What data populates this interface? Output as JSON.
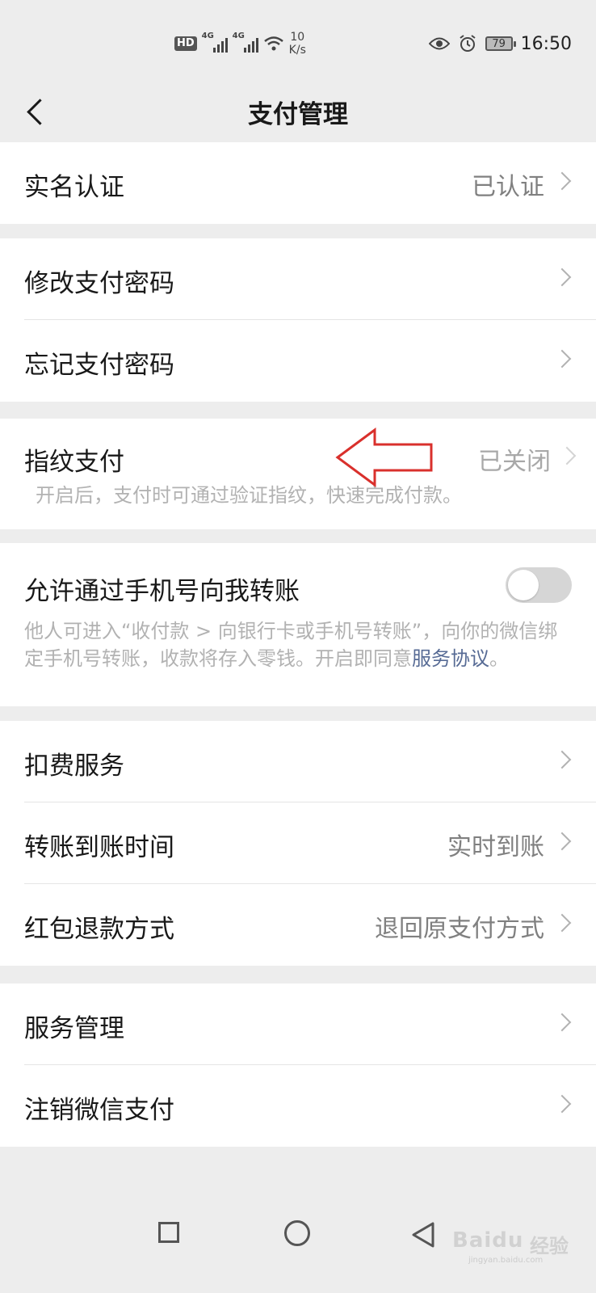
{
  "status_bar": {
    "hd": "HD",
    "network_1": "4G",
    "network_2": "4G",
    "speed_value": "10",
    "speed_unit": "K/s",
    "battery": "79",
    "time": "16:50"
  },
  "header": {
    "title": "支付管理"
  },
  "sections": {
    "real_name": {
      "label": "实名认证",
      "value": "已认证"
    },
    "password": {
      "change_label": "修改支付密码",
      "forgot_label": "忘记支付密码"
    },
    "fingerprint": {
      "label": "指纹支付",
      "value": "已关闭",
      "description": "开启后，支付时可通过验证指纹，快速完成付款。"
    },
    "phone_transfer": {
      "label": "允许通过手机号向我转账",
      "toggle_on": false,
      "description": "他人可进入“收付款 > 向银行卡或手机号转账”，向你的微信绑定手机号转账，收款将存入零钱。开启即同意",
      "link_text": "服务协议",
      "description_end": "。"
    },
    "services": {
      "deduction_label": "扣费服务",
      "transfer_time_label": "转账到账时间",
      "transfer_time_value": "实时到账",
      "refund_label": "红包退款方式",
      "refund_value": "退回原支付方式"
    },
    "manage": {
      "service_manage_label": "服务管理",
      "cancel_label": "注销微信支付"
    }
  },
  "watermark": {
    "brand": "Bai",
    "brand2": "du",
    "cn": "经验",
    "url": "jingyan.baidu.com"
  },
  "colors": {
    "background": "#ededed",
    "link": "#576b95",
    "annotation_arrow": "#d9302c"
  }
}
